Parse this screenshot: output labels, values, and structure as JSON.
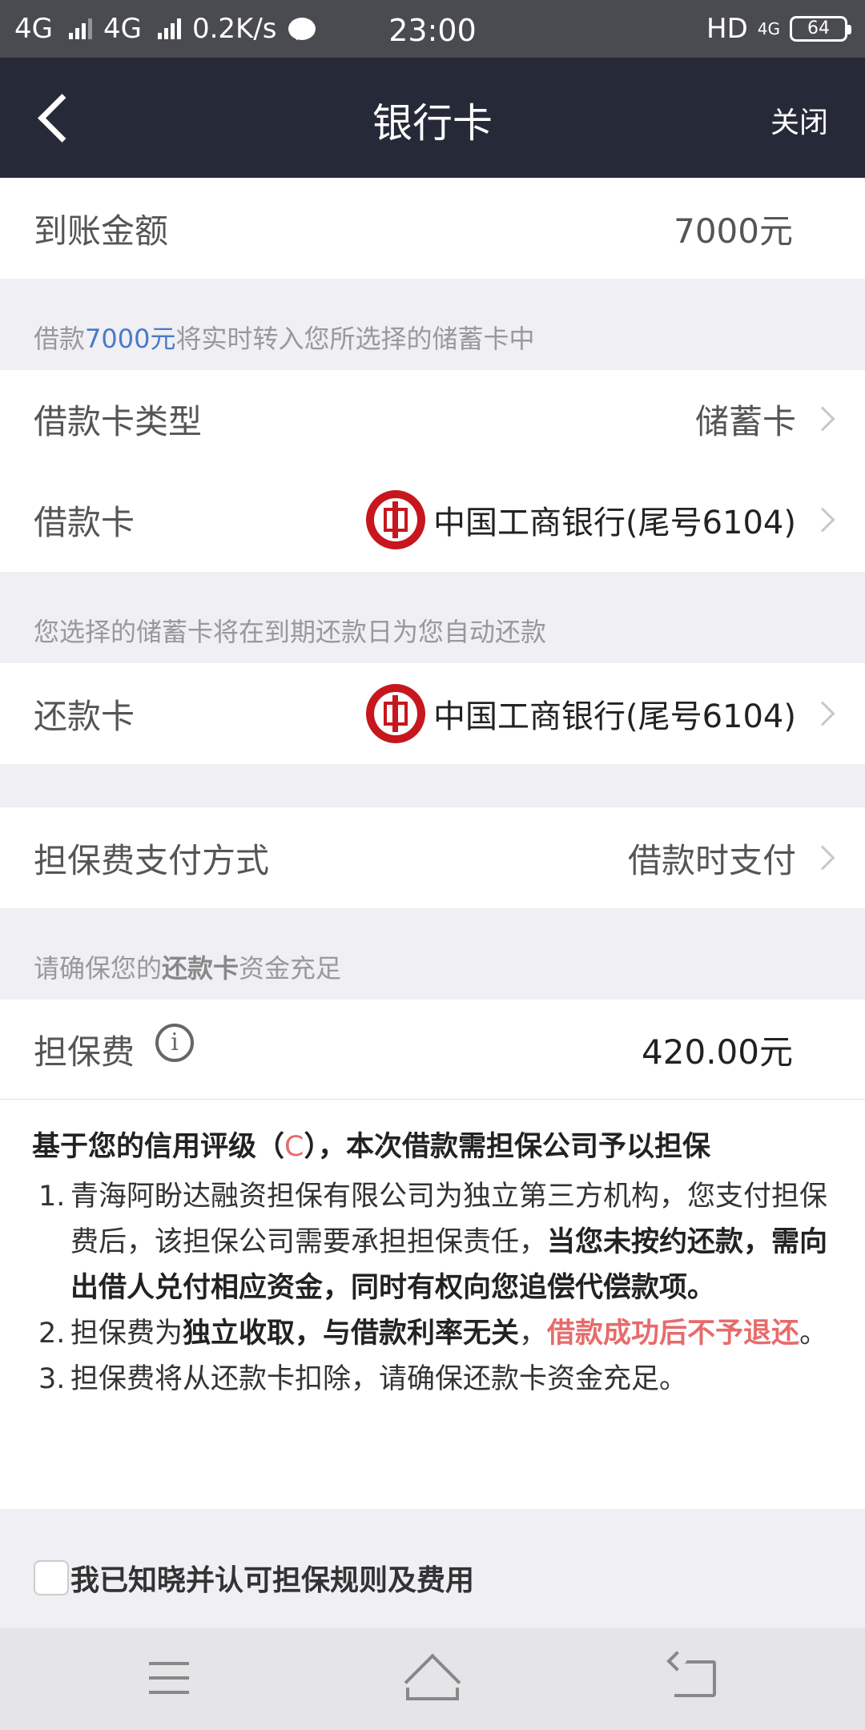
{
  "status_bar": {
    "net1": "4G",
    "net2": "4G",
    "speed": "0.2K/s",
    "time": "23:00",
    "hd": "HD",
    "net3": "4G",
    "battery": "64"
  },
  "header": {
    "title": "银行卡",
    "close_label": "关闭"
  },
  "amount": {
    "label": "到账金额",
    "value": "7000元"
  },
  "note_transfer": {
    "prefix": "借款",
    "amount": "7000元",
    "suffix": "将实时转入您所选择的储蓄卡中"
  },
  "card_type": {
    "label": "借款卡类型",
    "value": "储蓄卡"
  },
  "loan_card": {
    "label": "借款卡",
    "bank": "中国工商银行(尾号6104)"
  },
  "note_autopay": "您选择的储蓄卡将在到期还款日为您自动还款",
  "repay_card": {
    "label": "还款卡",
    "bank": "中国工商银行(尾号6104)"
  },
  "fee_method": {
    "label": "担保费支付方式",
    "value": "借款时支付"
  },
  "note_fund": {
    "prefix": "请确保您的",
    "bold": "还款卡",
    "suffix": "资金充足"
  },
  "guarantee_fee": {
    "label": "担保费",
    "info_glyph": "i",
    "value": "420.00元"
  },
  "terms": {
    "heading_prefix": "基于您的信用评级（",
    "grade": "C",
    "heading_suffix": "），本次借款需担保公司予以担保",
    "items": [
      {
        "num": "1.",
        "normal": "青海阿盼达融资担保有限公司为独立第三方机构，您支付担保费后，该担保公司需要承担担保责任，",
        "bold": "当您未按约还款，需向出借人兑付相应资金，同时有权向您追偿代偿款项。"
      },
      {
        "num": "2.",
        "normal": "担保费为",
        "bold": "独立收取，与借款利率无关",
        "sep": "，",
        "red": "借款成功后不予退还",
        "end": "。"
      },
      {
        "num": "3.",
        "normal": "担保费将从还款卡扣除，请确保还款卡资金充足。"
      }
    ]
  },
  "agree": {
    "label": "我已知晓并认可担保规则及费用",
    "checked": false
  },
  "nav_icons": [
    "menu-icon",
    "home-icon",
    "back-icon"
  ]
}
